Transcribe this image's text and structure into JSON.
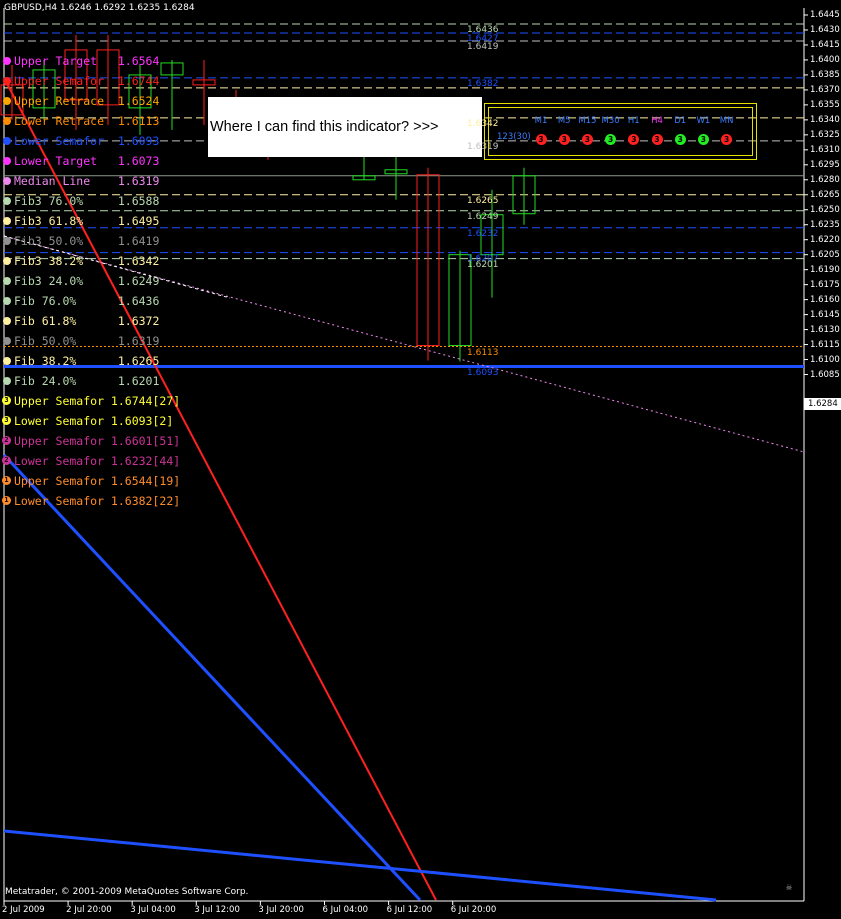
{
  "header": {
    "title": "GBPUSD,H4  1.6246 1.6292 1.6235 1.6284"
  },
  "legend": [
    {
      "text": "Upper Target   1.6564",
      "color": "#ff33ff",
      "marker": "dot"
    },
    {
      "text": "Upper Semafor  1.6744",
      "color": "#ff2020",
      "marker": "dot"
    },
    {
      "text": "Upper Retrace  1.6524",
      "color": "#ffa500",
      "marker": "dot"
    },
    {
      "text": "Lower Retrace  1.6113",
      "color": "#ff8c00",
      "marker": "dot"
    },
    {
      "text": "Lower Semafor  1.6093",
      "color": "#1e50ff",
      "marker": "dot"
    },
    {
      "text": "Lower Target   1.6073",
      "color": "#ff33ff",
      "marker": "dot"
    },
    {
      "text": "Median Line    1.6319",
      "color": "#ee88ee",
      "marker": "dot"
    },
    {
      "text": "Fib3 76.0%     1.6588",
      "color": "#b8d8b0",
      "marker": "dot"
    },
    {
      "text": "Fib3 61.8%     1.6495",
      "color": "#fff0a0",
      "marker": "dot"
    },
    {
      "text": "Fib3 50.0%     1.6419",
      "color": "#909090",
      "marker": "dot"
    },
    {
      "text": "Fib3 38.2%     1.6342",
      "color": "#fff0a0",
      "marker": "dot"
    },
    {
      "text": "Fib3 24.0%     1.6249",
      "color": "#b8d8b0",
      "marker": "dot"
    },
    {
      "text": "Fib 76.0%      1.6436",
      "color": "#b8d8b0",
      "marker": "dot"
    },
    {
      "text": "Fib 61.8%      1.6372",
      "color": "#fff0a0",
      "marker": "dot"
    },
    {
      "text": "Fib 50.0%      1.6319",
      "color": "#909090",
      "marker": "dot"
    },
    {
      "text": "Fib 38.2%      1.6265",
      "color": "#fff0a0",
      "marker": "dot"
    },
    {
      "text": "Fib 24.0%      1.6201",
      "color": "#b8d8b0",
      "marker": "dot"
    },
    {
      "text": "Upper Semafor 1.6744[27]",
      "color": "#ffff33",
      "marker": "3"
    },
    {
      "text": "Lower Semafor 1.6093[2]",
      "color": "#ffff33",
      "marker": "3"
    },
    {
      "text": "Upper Semafor 1.6601[51]",
      "color": "#cc3399",
      "marker": "2"
    },
    {
      "text": "Lower Semafor 1.6232[44]",
      "color": "#cc3399",
      "marker": "2"
    },
    {
      "text": "Upper Semafor 1.6544[19]",
      "color": "#ff8c2a",
      "marker": "1"
    },
    {
      "text": "Lower Semafor 1.6382[22]",
      "color": "#ff8c2a",
      "marker": "1"
    }
  ],
  "question": "Where I can find this indicator? >>>",
  "timeframes": {
    "name": "123(30)",
    "items": [
      {
        "label": "M1",
        "value": "3",
        "color": "#ff2020",
        "label_color": "#3b7dff"
      },
      {
        "label": "M5",
        "value": "3",
        "color": "#ff2020",
        "label_color": "#3b7dff"
      },
      {
        "label": "M15",
        "value": "3",
        "color": "#ff2020",
        "label_color": "#3b7dff"
      },
      {
        "label": "M30",
        "value": "3",
        "color": "#22ee22",
        "label_color": "#3b7dff"
      },
      {
        "label": "H1",
        "value": "3",
        "color": "#ff2020",
        "label_color": "#3b7dff"
      },
      {
        "label": "H4",
        "value": "3",
        "color": "#ff2020",
        "label_color": "#ff33ff"
      },
      {
        "label": "D1",
        "value": "3",
        "color": "#22ee22",
        "label_color": "#3b7dff"
      },
      {
        "label": "W1",
        "value": "3",
        "color": "#22ee22",
        "label_color": "#3b7dff"
      },
      {
        "label": "MN",
        "value": "3",
        "color": "#ff2020",
        "label_color": "#3b7dff"
      }
    ]
  },
  "levels": [
    {
      "label": "1.6436",
      "price": 1.6436,
      "color": "#b8d8b0",
      "style": "dash"
    },
    {
      "label": "1.6427",
      "price": 1.6427,
      "color": "#1e50ff",
      "style": "dash"
    },
    {
      "label": "1.6419",
      "price": 1.6419,
      "color": "#c0c0c0",
      "style": "dash"
    },
    {
      "label": "1.6382",
      "price": 1.6382,
      "color": "#1e50ff",
      "style": "dash"
    },
    {
      "label": "",
      "price": 1.6372,
      "color": "#fff0a0",
      "style": "dash"
    },
    {
      "label": "1.6342",
      "price": 1.6342,
      "color": "#fff0a0",
      "style": "dash"
    },
    {
      "label": "1.6319",
      "price": 1.6319,
      "color": "#c0c0c0",
      "style": "dash"
    },
    {
      "label": "1.6265",
      "price": 1.6265,
      "color": "#fff0a0",
      "style": "dash"
    },
    {
      "label": "1.6249",
      "price": 1.6249,
      "color": "#b8d8b0",
      "style": "dash"
    },
    {
      "label": "1.6232",
      "price": 1.6232,
      "color": "#1e50ff",
      "style": "dash"
    },
    {
      "label": "1.6207",
      "price": 1.6207,
      "color": "#1e50ff",
      "style": "dash"
    },
    {
      "label": "1.6201",
      "price": 1.6201,
      "color": "#b8d8b0",
      "style": "dash"
    },
    {
      "label": "1.6113",
      "price": 1.6113,
      "color": "#ff8c00",
      "style": "dot"
    },
    {
      "label": "1.6093",
      "price": 1.6093,
      "color": "#1e50ff",
      "style": "solid"
    }
  ],
  "y_ticks": [
    "1.6445",
    "1.6430",
    "1.6415",
    "1.6400",
    "1.6385",
    "1.6370",
    "1.6355",
    "1.6340",
    "1.6325",
    "1.6310",
    "1.6295",
    "1.6280",
    "1.6265",
    "1.6250",
    "1.6235",
    "1.6220",
    "1.6205",
    "1.6190",
    "1.6175",
    "1.6160",
    "1.6145",
    "1.6130",
    "1.6115",
    "1.6100",
    "1.6085"
  ],
  "x_ticks": [
    "2 Jul 2009",
    "2 Jul 20:00",
    "3 Jul 04:00",
    "3 Jul 12:00",
    "3 Jul 20:00",
    "6 Jul 04:00",
    "6 Jul 12:00",
    "6 Jul 20:00"
  ],
  "current_price": "1.6284",
  "copyright": "Metatrader, © 2001-2009 MetaQuotes Software Corp.",
  "chart_data": {
    "type": "candlestick",
    "symbol": "GBPUSD",
    "timeframe": "H4",
    "ylim": [
      1.608,
      1.645
    ],
    "grid": false,
    "candles": [
      {
        "o": 1.6375,
        "h": 1.6395,
        "l": 1.634,
        "c": 1.6345
      },
      {
        "o": 1.6352,
        "h": 1.64,
        "l": 1.634,
        "c": 1.639
      },
      {
        "o": 1.641,
        "h": 1.6425,
        "l": 1.633,
        "c": 1.636
      },
      {
        "o": 1.641,
        "h": 1.6425,
        "l": 1.6335,
        "c": 1.6355
      },
      {
        "o": 1.6352,
        "h": 1.6395,
        "l": 1.6325,
        "c": 1.6385
      },
      {
        "o": 1.6385,
        "h": 1.64,
        "l": 1.633,
        "c": 1.6397
      },
      {
        "o": 1.638,
        "h": 1.64,
        "l": 1.6335,
        "c": 1.6375
      },
      {
        "o": 1.6345,
        "h": 1.637,
        "l": 1.6305,
        "c": 1.633
      },
      {
        "o": 1.634,
        "h": 1.635,
        "l": 1.63,
        "c": 1.6325
      },
      {
        "o": 1.6328,
        "h": 1.6355,
        "l": 1.631,
        "c": 1.633
      },
      {
        "o": 1.633,
        "h": 1.6332,
        "l": 1.6315,
        "c": 1.6332
      },
      {
        "o": 1.628,
        "h": 1.6313,
        "l": 1.628,
        "c": 1.6284
      },
      {
        "o": 1.6286,
        "h": 1.6325,
        "l": 1.626,
        "c": 1.629
      },
      {
        "o": 1.6285,
        "h": 1.6292,
        "l": 1.6099,
        "c": 1.6114
      },
      {
        "o": 1.6114,
        "h": 1.6209,
        "l": 1.6098,
        "c": 1.6205
      },
      {
        "o": 1.6205,
        "h": 1.627,
        "l": 1.6162,
        "c": 1.6245
      },
      {
        "o": 1.6246,
        "h": 1.6292,
        "l": 1.6235,
        "c": 1.6284
      }
    ]
  }
}
